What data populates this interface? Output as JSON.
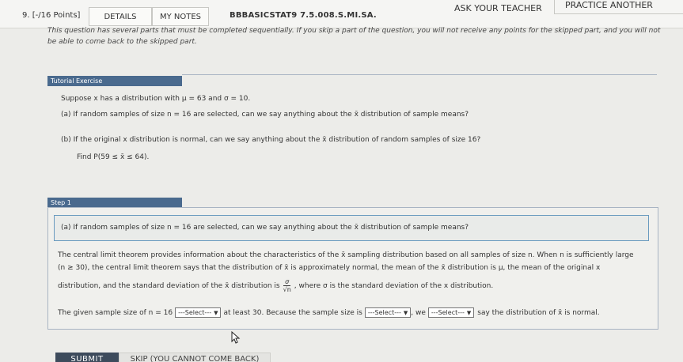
{
  "header": {
    "question_number": "9. [-/16 Points]",
    "details_label": "DETAILS",
    "my_notes_label": "MY NOTES",
    "course_code": "BBBASICSTAT9 7.5.008.S.MI.SA.",
    "ask_teacher_label": "ASK YOUR TEACHER",
    "practice_label": "PRACTICE ANOTHER"
  },
  "instructions": "This question has several parts that must be completed sequentially. If you skip a part of the question, you will not receive any points for the skipped part, and you will not be able to come back to the skipped part.",
  "tutorial": {
    "header": "Tutorial Exercise",
    "intro": "Suppose x has a distribution with μ = 63 and σ = 10.",
    "part_a": "(a)  If random samples of size n = 16 are selected, can we say anything about the x̄ distribution of sample means?",
    "part_b": "(b)  If the original x distribution is normal, can we say anything about the x̄ distribution of random samples of size 16?",
    "find": "Find P(59 ≤ x̄ ≤ 64)."
  },
  "step": {
    "header": "Step 1",
    "subquestion": "(a)  If random samples of size n = 16 are selected, can we say anything about the x̄ distribution of sample means?",
    "para1_line1": "The central limit theorem provides information about the characteristics of the x̄ sampling distribution based on all samples of size n. When n is sufficiently large",
    "para1_line2": "(n ≥ 30), the central limit theorem says that the distribution of x̄ is approximately normal, the mean of the x̄ distribution is μ, the mean of the original x",
    "para1_line3_a": "distribution, and the standard deviation of the x̄ distribution is",
    "frac_num": "σ",
    "frac_den": "√n",
    "para1_line3_b": ", where σ is the standard deviation of the x distribution.",
    "given_a": "The given sample size of n = 16",
    "given_b": "at least 30. Because the sample size is",
    "given_c": ", we",
    "given_d": "say the distribution of x̄ is normal.",
    "select1": "---Select---",
    "select2": "---Select---",
    "select3": "---Select---"
  },
  "buttons": {
    "submit": "SUBMIT",
    "skip": "SKIP (YOU CANNOT COME BACK)"
  }
}
